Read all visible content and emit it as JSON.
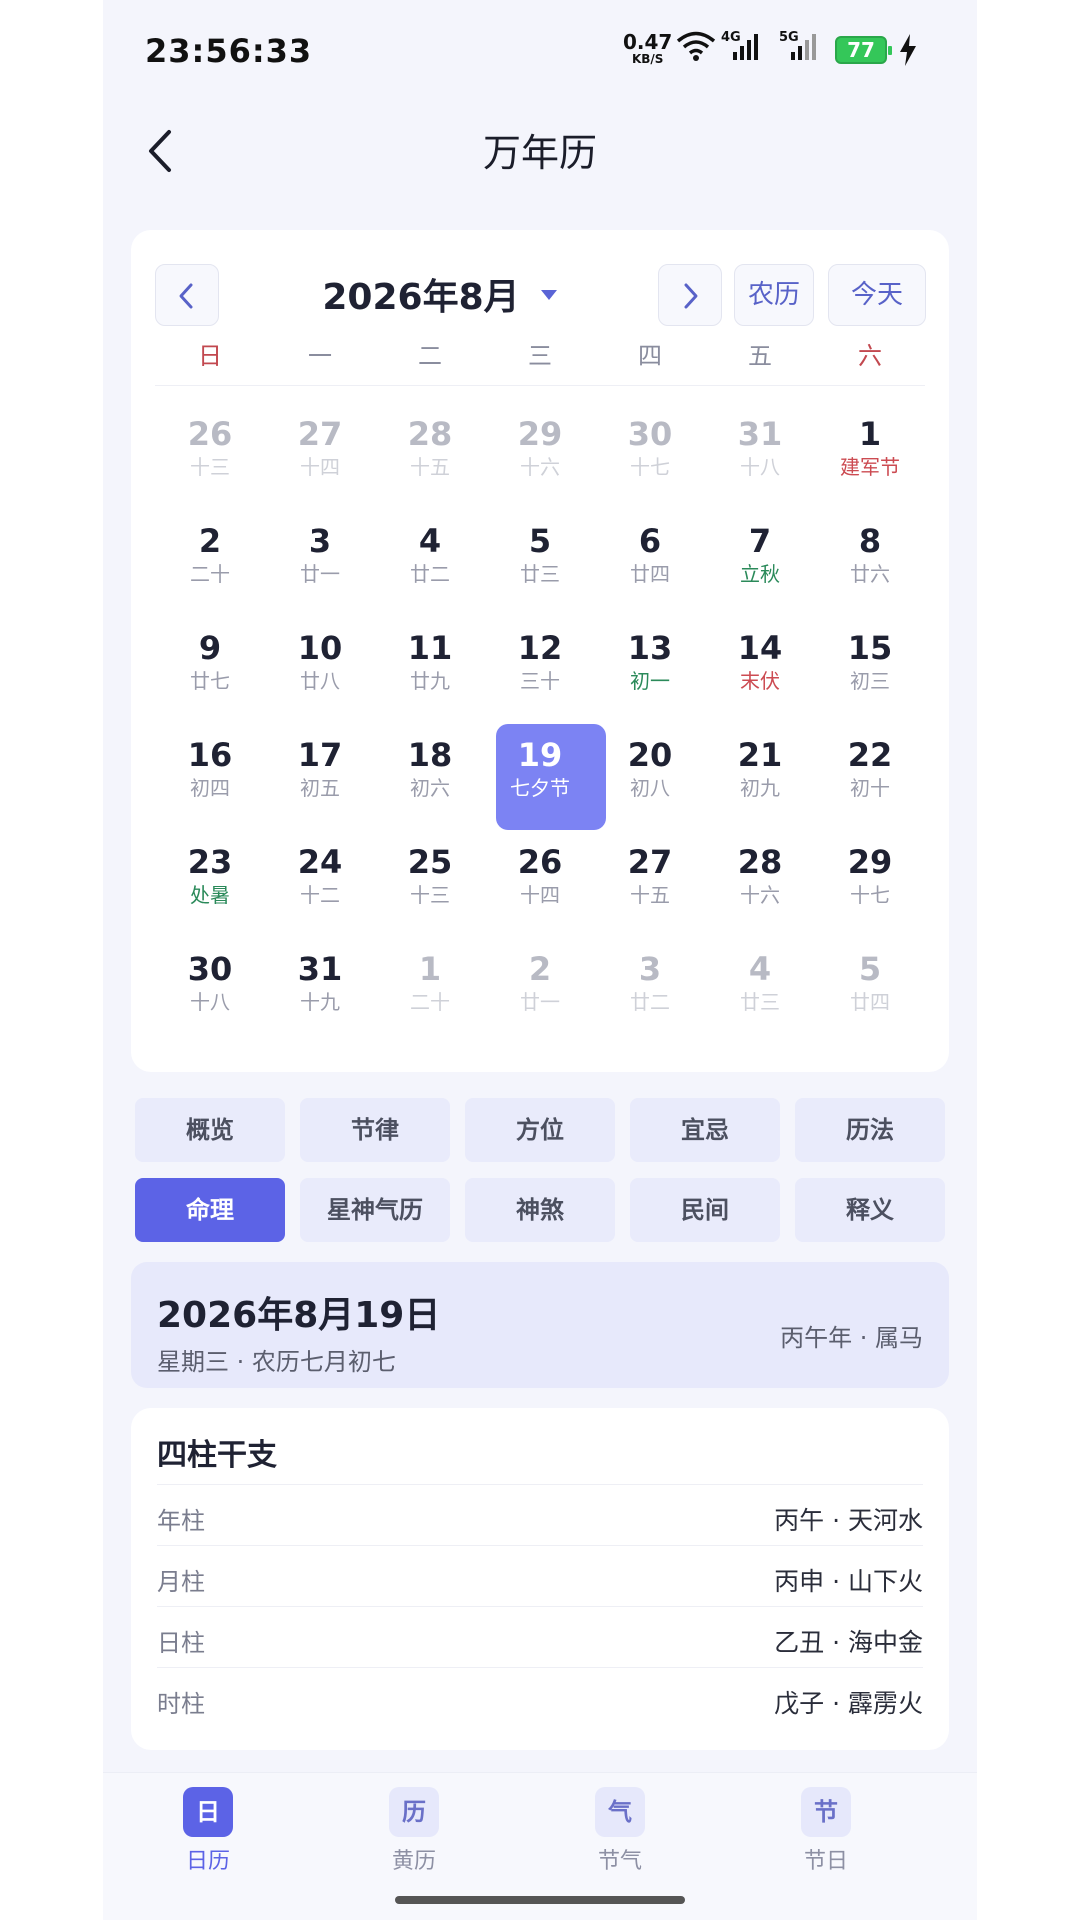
{
  "status_bar": {
    "time": "23:56:33",
    "net_speed": "0.47",
    "net_unit": "KB/S",
    "net_4g": "4G",
    "net_5g": "5G",
    "battery": "77",
    "battery_color": "#34c759"
  },
  "header": {
    "title": "万年历",
    "back_icon": "chevron-left-icon"
  },
  "calendar": {
    "month_label": "2026年8月",
    "lunar_button": "农历",
    "today_button": "今天",
    "weekdays": [
      "日",
      "一",
      "二",
      "三",
      "四",
      "五",
      "六"
    ],
    "selected_color": "#7c83f3",
    "days": [
      {
        "d": "26",
        "l": "十三",
        "muted": true
      },
      {
        "d": "27",
        "l": "十四",
        "muted": true
      },
      {
        "d": "28",
        "l": "十五",
        "muted": true
      },
      {
        "d": "29",
        "l": "十六",
        "muted": true
      },
      {
        "d": "30",
        "l": "十七",
        "muted": true
      },
      {
        "d": "31",
        "l": "十八",
        "muted": true
      },
      {
        "d": "1",
        "l": "建军节",
        "tone": "red"
      },
      {
        "d": "2",
        "l": "二十"
      },
      {
        "d": "3",
        "l": "廿一"
      },
      {
        "d": "4",
        "l": "廿二"
      },
      {
        "d": "5",
        "l": "廿三"
      },
      {
        "d": "6",
        "l": "廿四"
      },
      {
        "d": "7",
        "l": "立秋",
        "tone": "green"
      },
      {
        "d": "8",
        "l": "廿六"
      },
      {
        "d": "9",
        "l": "廿七"
      },
      {
        "d": "10",
        "l": "廿八"
      },
      {
        "d": "11",
        "l": "廿九"
      },
      {
        "d": "12",
        "l": "三十"
      },
      {
        "d": "13",
        "l": "初一",
        "tone": "green"
      },
      {
        "d": "14",
        "l": "末伏",
        "tone": "red"
      },
      {
        "d": "15",
        "l": "初三"
      },
      {
        "d": "16",
        "l": "初四"
      },
      {
        "d": "17",
        "l": "初五"
      },
      {
        "d": "18",
        "l": "初六"
      },
      {
        "d": "19",
        "l": "七夕节",
        "selected": true
      },
      {
        "d": "20",
        "l": "初八"
      },
      {
        "d": "21",
        "l": "初九"
      },
      {
        "d": "22",
        "l": "初十"
      },
      {
        "d": "23",
        "l": "处暑",
        "tone": "green"
      },
      {
        "d": "24",
        "l": "十二"
      },
      {
        "d": "25",
        "l": "十三"
      },
      {
        "d": "26",
        "l": "十四"
      },
      {
        "d": "27",
        "l": "十五"
      },
      {
        "d": "28",
        "l": "十六"
      },
      {
        "d": "29",
        "l": "十七"
      },
      {
        "d": "30",
        "l": "十八"
      },
      {
        "d": "31",
        "l": "十九"
      },
      {
        "d": "1",
        "l": "二十",
        "muted": true
      },
      {
        "d": "2",
        "l": "廿一",
        "muted": true
      },
      {
        "d": "3",
        "l": "廿二",
        "muted": true
      },
      {
        "d": "4",
        "l": "廿三",
        "muted": true
      },
      {
        "d": "5",
        "l": "廿四",
        "muted": true
      }
    ]
  },
  "tabs": [
    {
      "label": "概览"
    },
    {
      "label": "节律"
    },
    {
      "label": "方位"
    },
    {
      "label": "宜忌"
    },
    {
      "label": "历法"
    },
    {
      "label": "命理",
      "active": true
    },
    {
      "label": "星神气历"
    },
    {
      "label": "神煞"
    },
    {
      "label": "民间"
    },
    {
      "label": "释义"
    }
  ],
  "summary": {
    "date": "2026年8月19日",
    "sub": "星期三 · 农历七月初七",
    "right": "丙午年 · 属马"
  },
  "pillars": {
    "title": "四柱干支",
    "rows": [
      {
        "k": "年柱",
        "v": "丙午 · 天河水"
      },
      {
        "k": "月柱",
        "v": "丙申 · 山下火"
      },
      {
        "k": "日柱",
        "v": "乙丑 · 海中金"
      },
      {
        "k": "时柱",
        "v": "戊子 · 霹雳火"
      }
    ]
  },
  "bottom_nav": [
    {
      "icon": "日",
      "label": "日历",
      "active": true
    },
    {
      "icon": "历",
      "label": "黄历"
    },
    {
      "icon": "气",
      "label": "节气"
    },
    {
      "icon": "节",
      "label": "节日"
    }
  ],
  "accent_color": "#5c63e6"
}
